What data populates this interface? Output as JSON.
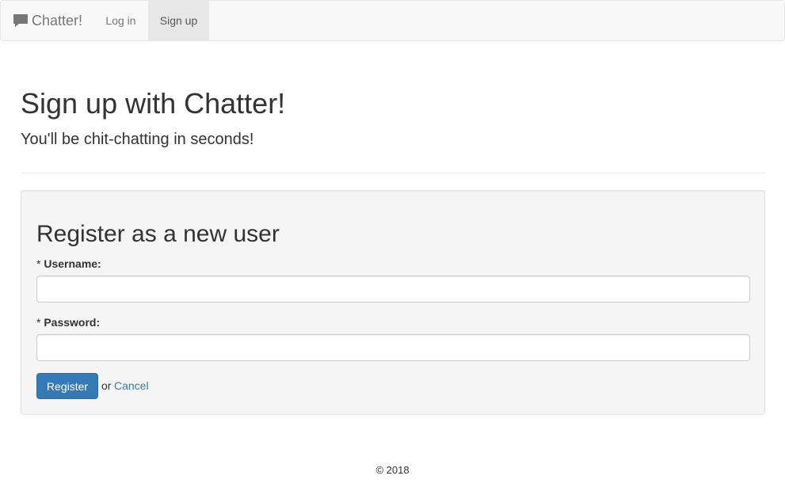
{
  "navbar": {
    "brand_icon": "comment-icon",
    "brand_label": "Chatter!",
    "items": [
      {
        "label": "Log in",
        "active": false
      },
      {
        "label": "Sign up",
        "active": true
      }
    ]
  },
  "header": {
    "title": "Sign up with Chatter!",
    "subtitle": "You'll be chit-chatting in seconds!"
  },
  "form": {
    "title": "Register as a new user",
    "required_marker": "*",
    "username_label": "Username:",
    "username_value": "",
    "password_label": "Password:",
    "password_value": "",
    "register_label": "Register",
    "or_text": "or",
    "cancel_label": "Cancel"
  },
  "footer": {
    "text": "© 2018"
  },
  "colors": {
    "primary": "#337ab7",
    "navbar_bg": "#f8f8f8",
    "well_bg": "#f5f5f5"
  }
}
